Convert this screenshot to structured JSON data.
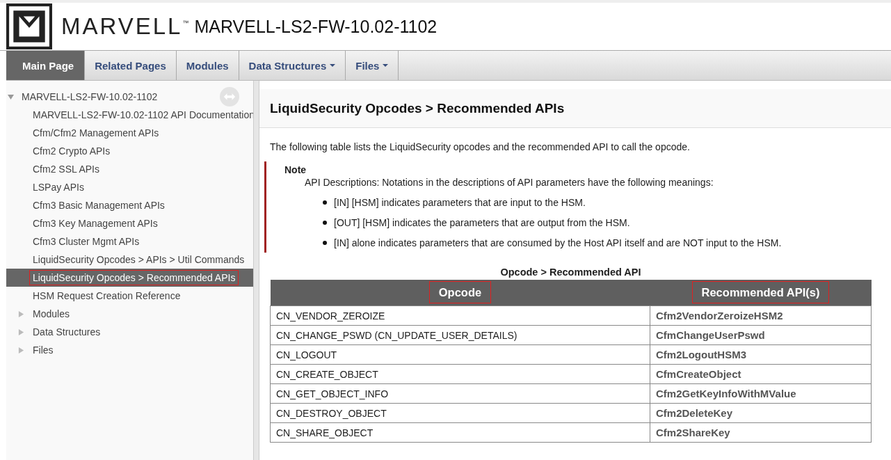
{
  "header": {
    "logo_text": "MARVELL",
    "trademark": "™",
    "project": "MARVELL-LS2-FW-10.02-1102"
  },
  "tabs": [
    {
      "label": "Main Page",
      "selected": true,
      "dropdown": false
    },
    {
      "label": "Related Pages",
      "selected": false,
      "dropdown": false
    },
    {
      "label": "Modules",
      "selected": false,
      "dropdown": false
    },
    {
      "label": "Data Structures",
      "selected": false,
      "dropdown": true
    },
    {
      "label": "Files",
      "selected": false,
      "dropdown": true
    }
  ],
  "sidebar": {
    "items": [
      {
        "label": "MARVELL-LS2-FW-10.02-1102",
        "expanded": true,
        "selected": false,
        "children": [
          {
            "label": "MARVELL-LS2-FW-10.02-1102 API Documentation",
            "selected": false,
            "highlighted": false
          },
          {
            "label": "Cfm/Cfm2 Management APIs",
            "selected": false,
            "highlighted": false
          },
          {
            "label": "Cfm2 Crypto APIs",
            "selected": false,
            "highlighted": false
          },
          {
            "label": "Cfm2 SSL APIs",
            "selected": false,
            "highlighted": false
          },
          {
            "label": "LSPay APIs",
            "selected": false,
            "highlighted": false
          },
          {
            "label": "Cfm3 Basic Management APIs",
            "selected": false,
            "highlighted": false
          },
          {
            "label": "Cfm3 Key Management APIs",
            "selected": false,
            "highlighted": false
          },
          {
            "label": "Cfm3 Cluster Mgmt APIs",
            "selected": false,
            "highlighted": false
          },
          {
            "label": "LiquidSecurity Opcodes > APIs > Util Commands",
            "selected": false,
            "highlighted": false
          },
          {
            "label": "LiquidSecurity Opcodes > Recommended APIs",
            "selected": true,
            "highlighted": true
          },
          {
            "label": "HSM Request Creation Reference",
            "selected": false,
            "highlighted": false
          },
          {
            "label": "Modules",
            "expanded": false,
            "selected": false,
            "highlighted": false
          },
          {
            "label": "Data Structures",
            "expanded": false,
            "selected": false,
            "highlighted": false
          },
          {
            "label": "Files",
            "expanded": false,
            "selected": false,
            "highlighted": false
          }
        ]
      }
    ]
  },
  "content": {
    "title": "LiquidSecurity Opcodes > Recommended APIs",
    "intro": "The following table lists the LiquidSecurity opcodes and the recommended API to call the opcode.",
    "note": {
      "heading": "Note",
      "text": "API Descriptions: Notations in the descriptions of API parameters have the following meanings:",
      "bullets": [
        "[IN] [HSM] indicates parameters that are input to the HSM.",
        "[OUT] [HSM] indicates the parameters that are output from the HSM.",
        "[IN] alone indicates parameters that are consumed by the Host API itself and are NOT input to the HSM."
      ]
    },
    "table": {
      "caption": "Opcode > Recommended API",
      "columns": [
        {
          "label": "Opcode",
          "highlighted": true
        },
        {
          "label": "Recommended API(s)",
          "highlighted": true
        }
      ],
      "rows": [
        [
          "CN_VENDOR_ZEROIZE",
          "Cfm2VendorZeroizeHSM2"
        ],
        [
          "CN_CHANGE_PSWD (CN_UPDATE_USER_DETAILS)",
          "CfmChangeUserPswd"
        ],
        [
          "CN_LOGOUT",
          "Cfm2LogoutHSM3"
        ],
        [
          "CN_CREATE_OBJECT",
          "CfmCreateObject"
        ],
        [
          "CN_GET_OBJECT_INFO",
          "Cfm2GetKeyInfoWithMValue"
        ],
        [
          "CN_DESTROY_OBJECT",
          "Cfm2DeleteKey"
        ],
        [
          "CN_SHARE_OBJECT",
          "Cfm2ShareKey"
        ]
      ]
    }
  }
}
